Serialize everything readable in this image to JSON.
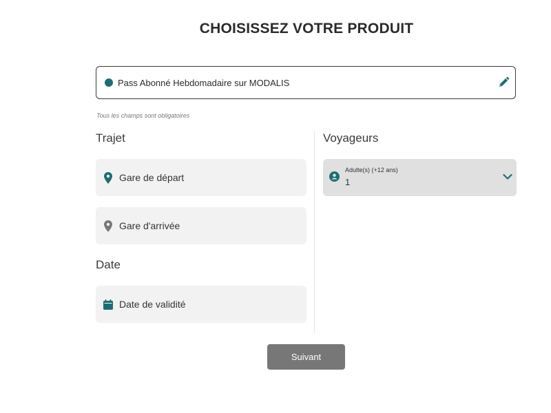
{
  "page": {
    "title": "CHOISISSEZ VOTRE PRODUIT"
  },
  "product": {
    "label": "Pass Abonné Hebdomadaire sur MODALIS",
    "dot_color": "#1d6e72",
    "edit_icon": "pencil-icon"
  },
  "form": {
    "required_note": "Tous les champs sont obligatoires"
  },
  "trajet": {
    "heading": "Trajet",
    "departure": {
      "label": "Gare de départ",
      "icon": "map-pin-icon",
      "icon_color": "#1d6e72"
    },
    "arrival": {
      "label": "Gare d'arrivée",
      "icon": "map-pin-icon",
      "icon_color": "#777777"
    }
  },
  "date": {
    "heading": "Date",
    "validity": {
      "label": "Date de validité",
      "icon": "calendar-icon",
      "icon_color": "#1d6e72"
    }
  },
  "voyageurs": {
    "heading": "Voyageurs",
    "category_label": "Adulte(s) (+12 ans)",
    "count": "1",
    "icon": "person-icon",
    "chevron_icon": "chevron-down-icon",
    "accent_color": "#1d6e72"
  },
  "actions": {
    "next_label": "Suivant",
    "next_color": "#777777"
  }
}
